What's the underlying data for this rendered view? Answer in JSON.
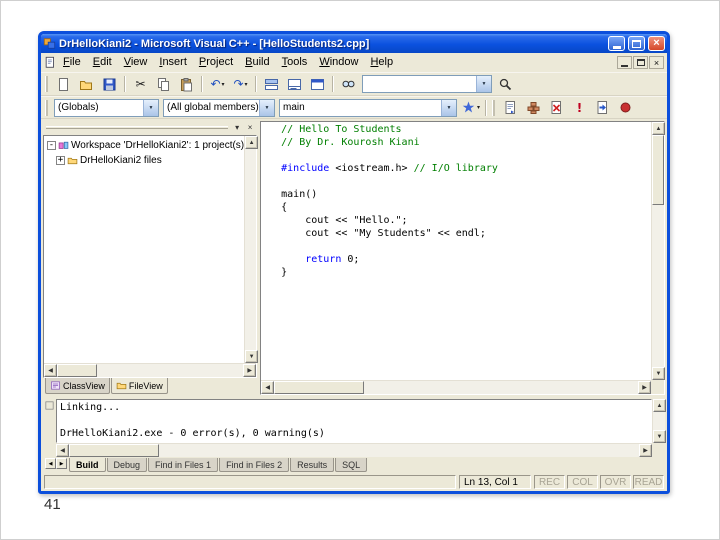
{
  "page": {
    "number": "41"
  },
  "colors": {
    "titlebar_blue": "#0c4fdc",
    "chrome_gray": "#ece9d8",
    "comment_green": "#007f00",
    "keyword_blue": "#0000ff"
  },
  "window": {
    "title": "DrHelloKiani2 - Microsoft Visual C++ - [HelloStudents2.cpp]"
  },
  "menu": {
    "items": [
      "File",
      "Edit",
      "View",
      "Insert",
      "Project",
      "Build",
      "Tools",
      "Window",
      "Help"
    ]
  },
  "toolbar_standard": [
    {
      "type": "button",
      "icon": "new-file-icon"
    },
    {
      "type": "button",
      "icon": "open-folder-icon"
    },
    {
      "type": "button",
      "icon": "save-icon"
    },
    {
      "type": "sep"
    },
    {
      "type": "button",
      "icon": "cut-icon"
    },
    {
      "type": "button",
      "icon": "copy-icon"
    },
    {
      "type": "button",
      "icon": "paste-icon"
    },
    {
      "type": "sep"
    },
    {
      "type": "button",
      "icon": "undo-icon",
      "dropdown": true
    },
    {
      "type": "button",
      "icon": "redo-icon",
      "dropdown": true
    },
    {
      "type": "sep"
    },
    {
      "type": "button",
      "icon": "workspace-icon"
    },
    {
      "type": "button",
      "icon": "output-icon"
    },
    {
      "type": "button",
      "icon": "window-list-icon"
    },
    {
      "type": "sep"
    },
    {
      "type": "button",
      "icon": "find-in-files-icon"
    },
    {
      "type": "combo",
      "value": ""
    },
    {
      "type": "button",
      "icon": "search-icon"
    }
  ],
  "toolbar_wizard": {
    "globals": "(Globals)",
    "members": "(All global members)",
    "function": "main",
    "action_icon": "wizard-action-icon"
  },
  "toolbar_build": [
    "compile-icon",
    "build-icon",
    "stop-build-icon",
    "execute-icon",
    "go-icon",
    "breakpoint-icon"
  ],
  "workspace_panel": {
    "root_label": "Workspace 'DrHelloKiani2': 1 project(s)",
    "project_label": "DrHelloKiani2 files",
    "tabs": [
      {
        "label": "ClassView",
        "icon": "classview-icon"
      },
      {
        "label": "FileView",
        "icon": "fileview-icon"
      }
    ],
    "active_tab": "FileView"
  },
  "editor": {
    "lines": [
      [
        {
          "t": "// Hello To Students",
          "c": "cmt"
        }
      ],
      [
        {
          "t": "// By Dr. Kourosh Kiani",
          "c": "cmt"
        }
      ],
      [],
      [
        {
          "t": "#include",
          "c": "kw"
        },
        {
          "t": " <iostream.h> ",
          "c": "txt"
        },
        {
          "t": "// I/O library",
          "c": "cmt"
        }
      ],
      [],
      [
        {
          "t": "main()",
          "c": "txt"
        }
      ],
      [
        {
          "t": "{",
          "c": "txt"
        }
      ],
      [
        {
          "t": "    cout << \"Hello.\";",
          "c": "txt"
        }
      ],
      [
        {
          "t": "    cout << \"My Students\" << endl;",
          "c": "txt"
        }
      ],
      [],
      [
        {
          "t": "    ",
          "c": "txt"
        },
        {
          "t": "return",
          "c": "kw"
        },
        {
          "t": " 0;",
          "c": "txt"
        }
      ],
      [
        {
          "t": "}",
          "c": "txt"
        }
      ]
    ]
  },
  "output_panel": {
    "lines": [
      "Linking...",
      "",
      "DrHelloKiani2.exe - 0 error(s), 0 warning(s)"
    ],
    "tabs": [
      "Build",
      "Debug",
      "Find in Files 1",
      "Find in Files 2",
      "Results",
      "SQL"
    ],
    "active_tab": "Build"
  },
  "status_bar": {
    "message": "",
    "position": "Ln 13, Col 1",
    "indicators": [
      "REC",
      "COL",
      "OVR",
      "READ"
    ]
  }
}
